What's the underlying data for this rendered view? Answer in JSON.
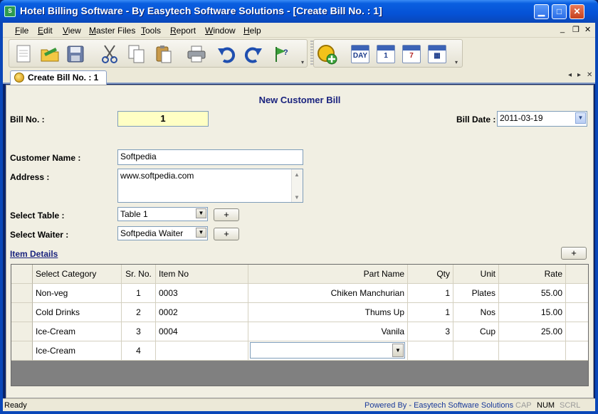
{
  "window": {
    "title": "Hotel Billing Software - By Easytech Software Solutions - [Create Bill No. : 1]",
    "app_icon_text": "S",
    "min_glyph": "▁",
    "max_glyph": "□",
    "close_glyph": "✕"
  },
  "menu": {
    "items": [
      "File",
      "Edit",
      "View",
      "Master Files",
      "Tools",
      "Report",
      "Window",
      "Help"
    ],
    "mdi_min": "_",
    "mdi_restore": "❐",
    "mdi_close": "✕"
  },
  "toolbar": {
    "cal_day": "DAY",
    "cal_1": "1",
    "cal_7": "7",
    "cal_grid": "▦"
  },
  "tab": {
    "label": "Create Bill No. : 1",
    "nav_left": "◂",
    "nav_right": "▸",
    "nav_close": "✕"
  },
  "form": {
    "heading": "New Customer Bill",
    "bill_no_label": "Bill No. :",
    "bill_no": "1",
    "bill_date_label": "Bill Date :",
    "bill_date": "2011-03-19",
    "customer_name_label": "Customer Name :",
    "customer_name": "Softpedia",
    "address_label": "Address :",
    "address": "www.softpedia.com",
    "table_label": "Select Table :",
    "table_value": "Table 1",
    "waiter_label": "Select Waiter :",
    "waiter_value": "Softpedia Waiter",
    "add_label": "+",
    "item_details_link": "Item Details",
    "dd_glyph": "▼"
  },
  "grid": {
    "headers": [
      "Select Category",
      "Sr. No.",
      "Item No",
      "Part Name",
      "Qty",
      "Unit",
      "Rate"
    ],
    "rows": [
      {
        "category": "Non-veg",
        "sr": "1",
        "item_no": "0003",
        "part": "Chiken Manchurian",
        "qty": "1",
        "unit": "Plates",
        "rate": "55.00"
      },
      {
        "category": "Cold Drinks",
        "sr": "2",
        "item_no": "0002",
        "part": "Thums Up",
        "qty": "1",
        "unit": "Nos",
        "rate": "15.00"
      },
      {
        "category": "Ice-Cream",
        "sr": "3",
        "item_no": "0004",
        "part": "Vanila",
        "qty": "3",
        "unit": "Cup",
        "rate": "25.00"
      },
      {
        "category": "Ice-Cream",
        "sr": "4",
        "item_no": "",
        "part": "",
        "qty": "",
        "unit": "",
        "rate": ""
      }
    ]
  },
  "status": {
    "ready": "Ready",
    "powered": "Powered By - Easytech Software Solutions",
    "cap": "CAP",
    "num": "NUM",
    "scrl": "SCRL"
  },
  "colors": {
    "title_bar": "#0552d6",
    "heading": "#1a237e",
    "bill_no_bg": "#ffffc4",
    "grid_bg": "#808080",
    "form_bg": "#f1efe3"
  }
}
